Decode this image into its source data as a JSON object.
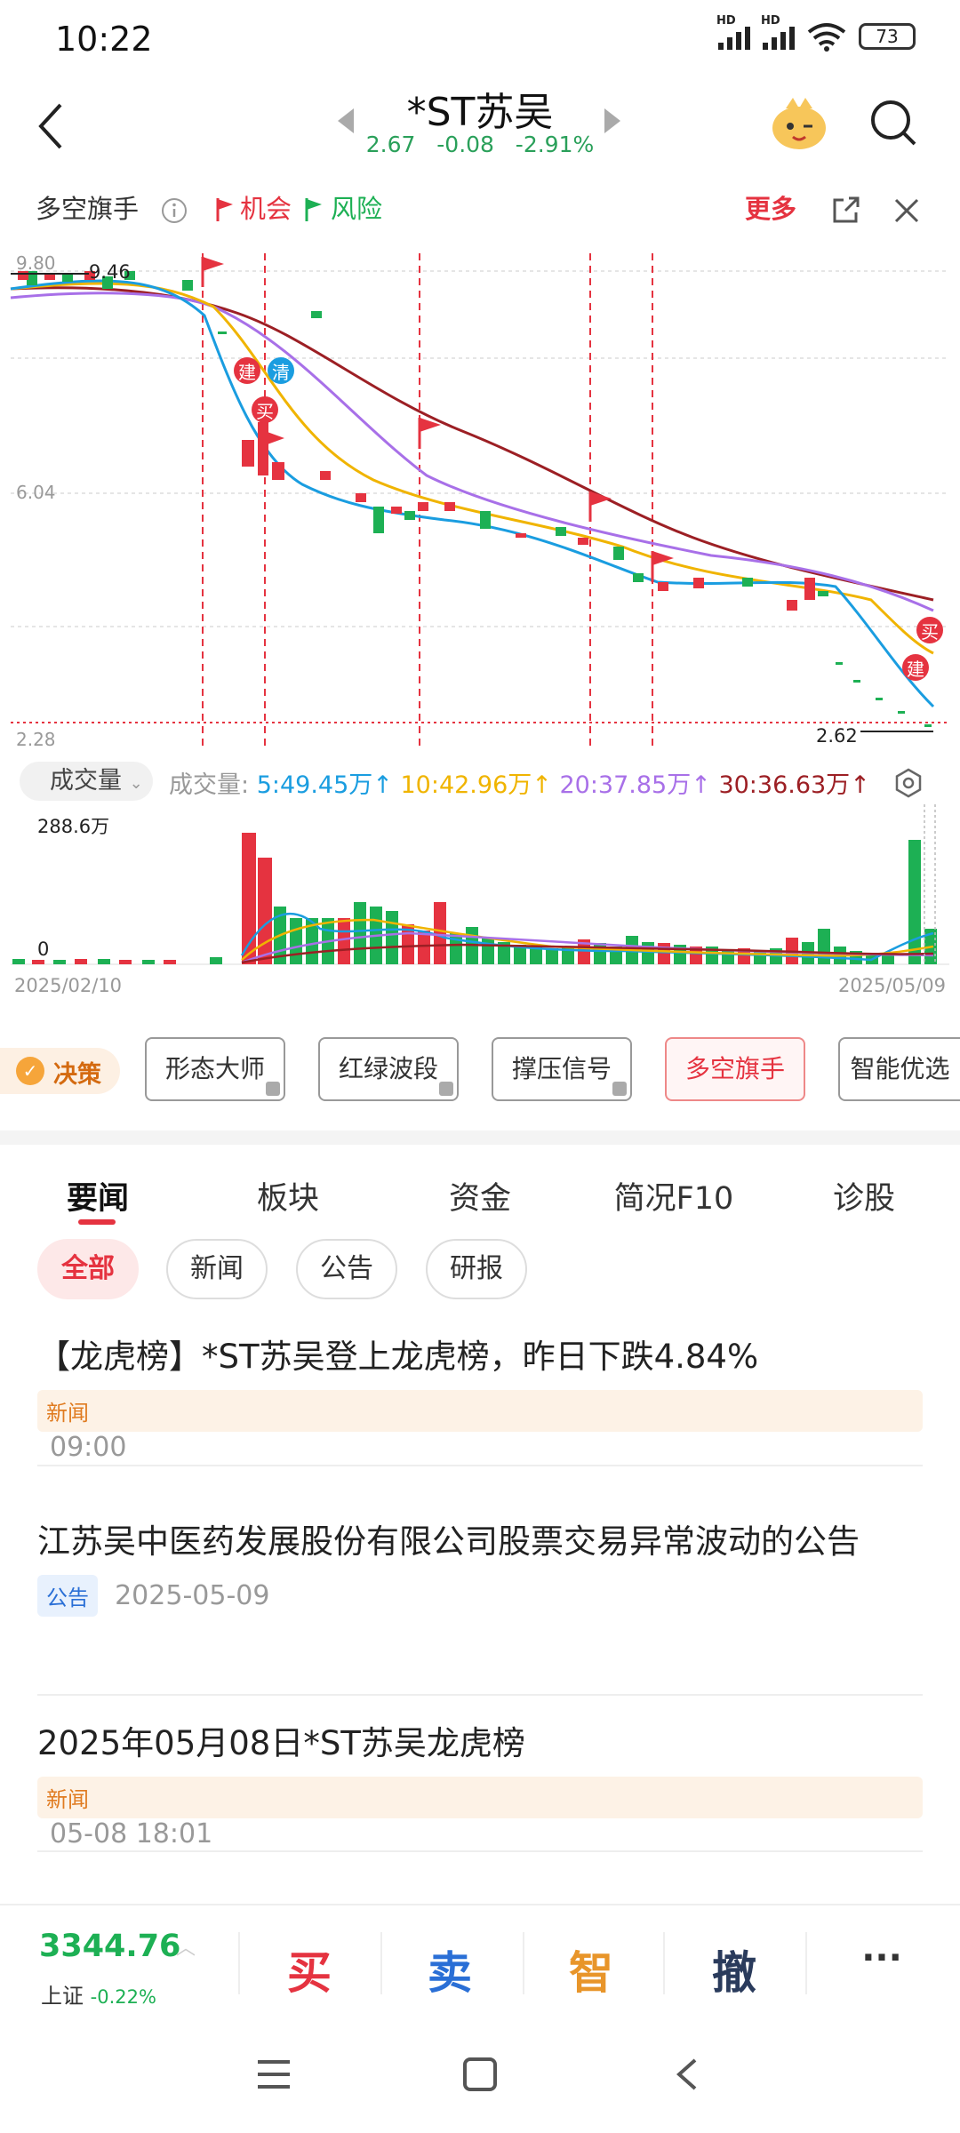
{
  "status": {
    "time": "10:22",
    "battery": "73",
    "hd1": "HD",
    "hd2": "HD"
  },
  "header": {
    "title": "*ST苏吴",
    "price": "2.67",
    "change": "-0.08",
    "change_pct": "-2.91%"
  },
  "toolbar": {
    "label": "多空旗手",
    "opportunity": "机会",
    "risk": "风险",
    "more": "更多"
  },
  "chart": {
    "price_labels": {
      "top": "9.80",
      "high": "9.46",
      "mid": "6.04",
      "low": "2.28",
      "last": "2.62"
    },
    "markers": {
      "build": "建",
      "clear": "清",
      "buy": "买"
    }
  },
  "volume": {
    "selector": "成交量",
    "label": "成交量:",
    "ma5": "5:49.45万",
    "ma10": "10:42.96万",
    "ma20": "20:37.85万",
    "ma30": "30:36.63万",
    "max_label": "288.6万",
    "zero_label": "0",
    "date_start": "2025/02/10",
    "date_end": "2025/05/09"
  },
  "tools": {
    "decision": "决策",
    "items": [
      "形态大师",
      "红绿波段",
      "撑压信号",
      "多空旗手",
      "智能优选"
    ]
  },
  "tabs": [
    "要闻",
    "板块",
    "资金",
    "简况F10",
    "诊股"
  ],
  "chips": [
    "全部",
    "新闻",
    "公告",
    "研报"
  ],
  "news": [
    {
      "title": "【龙虎榜】*ST苏吴登上龙虎榜，昨日下跌4.84%",
      "tag": "新闻",
      "time": "09:00"
    },
    {
      "title": "江苏吴中医药发展股份有限公司股票交易异常波动的公告",
      "tag": "公告",
      "time": "2025-05-09"
    },
    {
      "title": "2025年05月08日*ST苏吴龙虎榜",
      "tag": "新闻",
      "time": "05-08 18:01"
    }
  ],
  "bottom": {
    "index_value": "3344.76",
    "index_name": "上证",
    "index_change": "-0.22%",
    "buy": "买",
    "sell": "卖",
    "smart": "智",
    "cancel": "撤",
    "more": "···"
  },
  "colors": {
    "up": "#e53340",
    "down": "#1db054",
    "ma5": "#1a9de0",
    "ma10": "#f0b400",
    "ma20": "#a870e8",
    "ma30": "#9c1f24"
  }
}
